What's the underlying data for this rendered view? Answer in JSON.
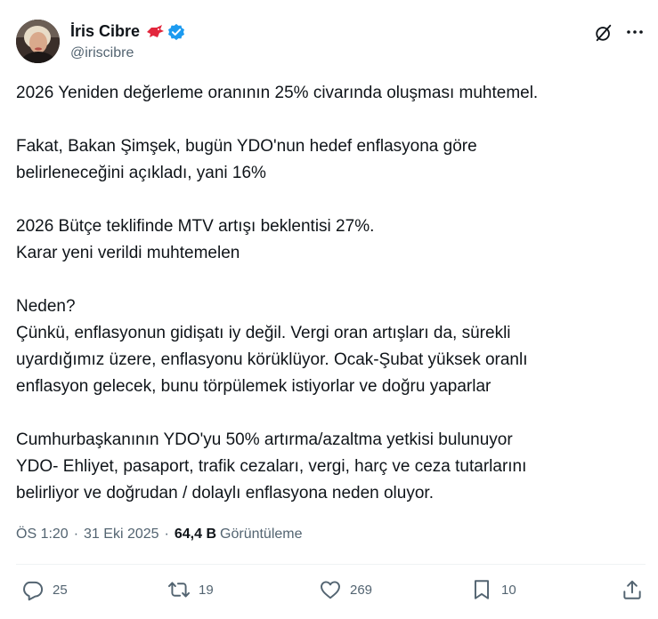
{
  "author": {
    "display_name": "İris Cibre",
    "handle": "@iriscibre",
    "badge_color": "#1d9bf0",
    "emoji_icon": "bird-emoji-icon"
  },
  "body": {
    "paragraphs": [
      [
        "2026 Yeniden değerleme oranının 25% civarında oluşması muhtemel."
      ],
      [
        "Fakat, Bakan Şimşek, bugün YDO'nun hedef enflasyona göre",
        "belirleneceğini açıkladı, yani 16%"
      ],
      [
        "2026 Bütçe teklifinde MTV artışı beklentisi 27%.",
        "Karar yeni verildi muhtemelen"
      ],
      [
        "Neden?",
        "Çünkü, enflasyonun gidişatı iy değil. Vergi oran artışları da, sürekli",
        "uyardığımız üzere, enflasyonu körüklüyor. Ocak-Şubat yüksek oranlı",
        "enflasyon gelecek, bunu törpülemek istiyorlar ve doğru yaparlar"
      ],
      [
        "Cumhurbaşkanının YDO'yu 50% artırma/azaltma yetkisi bulunuyor",
        "YDO- Ehliyet, pasaport, trafik cezaları, vergi, harç ve ceza tutarlarını",
        "belirliyor ve doğrudan / dolaylı enflasyona neden oluyor."
      ]
    ]
  },
  "meta": {
    "time": "ÖS 1:20",
    "separator": "·",
    "date": "31 Eki 2025",
    "views_count": "64,4 B",
    "views_label": "Görüntüleme"
  },
  "actions": {
    "replies": "25",
    "retweets": "19",
    "likes": "269",
    "bookmarks": "10"
  }
}
